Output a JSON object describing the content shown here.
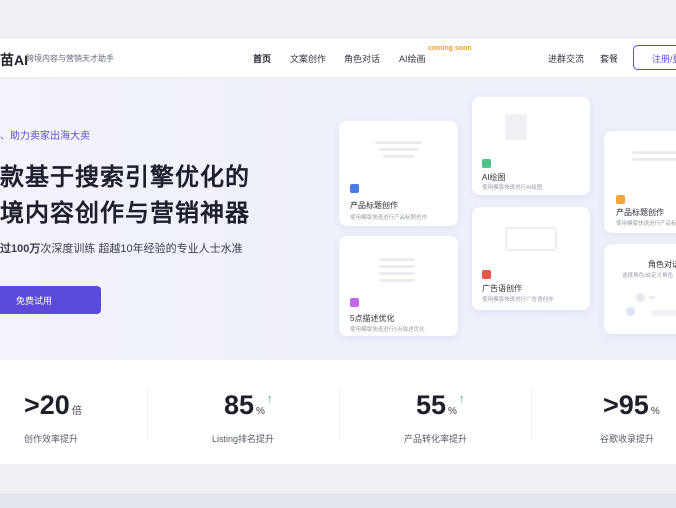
{
  "header": {
    "brand": "苗AI",
    "slogan": "跨境内容与营销天才助手",
    "nav": [
      "首页",
      "文案创作",
      "角色对话",
      "AI绘画"
    ],
    "coming_soon": "coming soon",
    "right_links": [
      "进群交流",
      "套餐"
    ],
    "register_label": "注册/登"
  },
  "hero": {
    "tagline": "助力卖家出海大卖",
    "headline_line1": "款基于搜索引擎优化的",
    "headline_line2": "境内容创作与营销神器",
    "subline_bold": "过100万",
    "subline_rest": "次深度训练 超越10年经验的专业人士水准",
    "cta_label": "免费试用"
  },
  "cards": [
    {
      "title": "产品标题创作",
      "desc": "使用模版快速进行产品标题创作",
      "icon_color": "#4a7de8"
    },
    {
      "title": "5点描述优化",
      "desc": "使用模版快速进行5点描述优化",
      "icon_color": "#c267e8"
    },
    {
      "title": "AI绘图",
      "desc": "使用模版快速进行AI绘图",
      "icon_color": "#4cc48a"
    },
    {
      "title": "广告语创作",
      "desc": "使用模版快速进行广告语创作",
      "icon_color": "#e8564a"
    },
    {
      "title": "产品标题创作",
      "desc": "使用模版快速进行产品标题创",
      "icon_color": "#f3a53d"
    },
    {
      "title": "角色对话",
      "desc": "选择角色/自定义角色"
    }
  ],
  "stats": [
    {
      "value": ">20",
      "unit": "倍",
      "label": "创作效率提升",
      "arrow": ""
    },
    {
      "value": "85",
      "unit": "%",
      "label": "Listing排名提升",
      "arrow": "↑"
    },
    {
      "value": "55",
      "unit": "%",
      "label": "产品转化率提升",
      "arrow": "↑"
    },
    {
      "value": ">95",
      "unit": "%",
      "label": "谷歌收录提升",
      "arrow": ""
    }
  ],
  "colors": {
    "accent": "#5b4bdb",
    "up": "#2db36b",
    "coming": "#f0a033"
  }
}
